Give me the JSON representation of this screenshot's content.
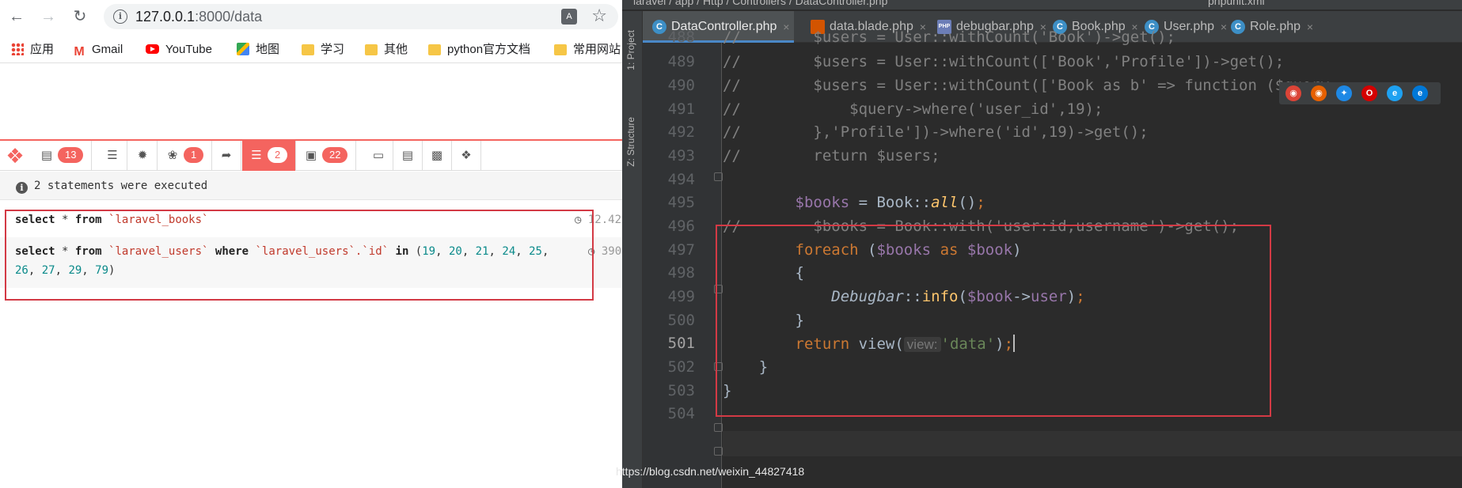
{
  "browser": {
    "url_host": "127.0.0.1",
    "url_path": ":8000/data",
    "bookmarks": [
      "应用",
      "Gmail",
      "YouTube",
      "地图",
      "学习",
      "其他",
      "python官方文档",
      "常用网站"
    ]
  },
  "debugbar": {
    "tabs": [
      {
        "icon": "messages-icon",
        "badge": "13"
      },
      {
        "icon": "timeline-icon",
        "badge": ""
      },
      {
        "icon": "exceptions-icon",
        "badge": ""
      },
      {
        "icon": "views-icon",
        "badge": "1"
      },
      {
        "icon": "route-icon",
        "badge": ""
      },
      {
        "icon": "queries-icon",
        "badge": "2"
      },
      {
        "icon": "models-icon",
        "badge": "22"
      },
      {
        "icon": "mails-icon",
        "badge": ""
      },
      {
        "icon": "request-icon",
        "badge": ""
      },
      {
        "icon": "session-icon",
        "badge": ""
      },
      {
        "icon": "tags-icon",
        "badge": ""
      }
    ],
    "active_tab": "queries",
    "status": "2 statements were executed",
    "statements": [
      {
        "kw1": "select",
        "mid": " * ",
        "kw2": "from",
        "table": "`laravel_books`",
        "duration": "12.42"
      },
      {
        "kw1": "select",
        "mid": " * ",
        "kw2": "from",
        "table": "`laravel_users`",
        "kw3": "where",
        "col": "`laravel_users`.`id`",
        "kw4": "in",
        "ids_line1": [
          "19",
          "20",
          "21",
          "24",
          "25"
        ],
        "ids_line2": [
          "26",
          "27",
          "29",
          "79"
        ],
        "duration": "390"
      }
    ]
  },
  "ide": {
    "breadcrumb": "laravel  /  app  /  Http  /  Controllers  /  DataController.php",
    "run_config": "phpunit.xml",
    "tabs": [
      {
        "label": "DataController.php",
        "icon": "php-class-icon",
        "active": true
      },
      {
        "label": "data.blade.php",
        "icon": "blade-file-icon",
        "active": false
      },
      {
        "label": "debugbar.php",
        "icon": "php-file-icon",
        "active": false
      },
      {
        "label": "Book.php",
        "icon": "php-class-icon",
        "active": false
      },
      {
        "label": "User.php",
        "icon": "php-class-icon",
        "active": false
      },
      {
        "label": "Role.php",
        "icon": "php-class-icon",
        "active": false
      }
    ],
    "side_labels": [
      "1: Project",
      "Z: Structure"
    ],
    "line_numbers": [
      "488",
      "489",
      "490",
      "491",
      "492",
      "493",
      "494",
      "495",
      "496",
      "497",
      "498",
      "499",
      "500",
      "501",
      "502",
      "503",
      "504"
    ],
    "current_line": "501",
    "code": {
      "l488": "//        $users = User::withCount('Book')->get();",
      "l489": "//        $users = User::withCount(['Book','Profile'])->get();",
      "l490": "//        $users = User::withCount(['Book as b' => function ($query",
      "l491": "//            $query->where('user_id',19);",
      "l492": "//        },'Profile'])->where('id',19)->get();",
      "l493": "//        return $users;",
      "l496": "//        $books = Book::with('user:id,username')->get();",
      "hint": "view:"
    }
  },
  "watermark": "https://blog.csdn.net/weixin_44827418"
}
